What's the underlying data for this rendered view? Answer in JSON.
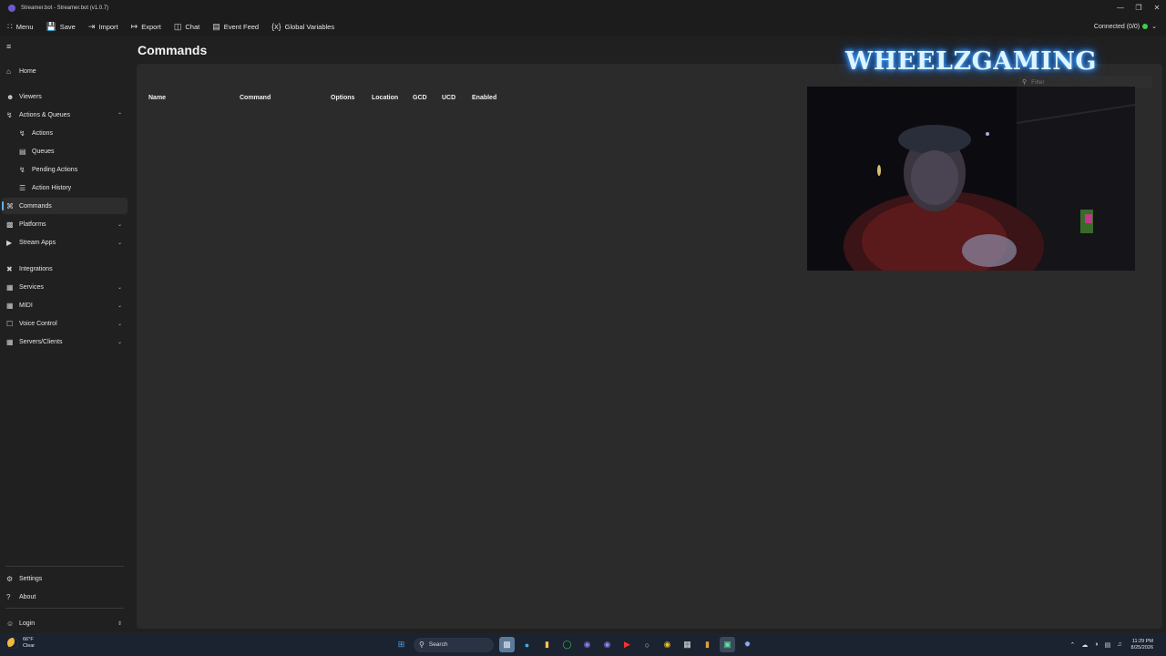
{
  "window": {
    "title": "Streamer.bot - Streamer.bot (v1.0.7)"
  },
  "toolbar": {
    "menu": "Menu",
    "save": "Save",
    "import": "Import",
    "export": "Export",
    "chat": "Chat",
    "event_feed": "Event Feed",
    "global_variables": "Global Variables",
    "connection_status": "Connected (0/0)"
  },
  "sidebar": {
    "home": "Home",
    "viewers": "Viewers",
    "actions_queues": "Actions & Queues",
    "actions": "Actions",
    "queues": "Queues",
    "pending_actions": "Pending Actions",
    "action_history": "Action History",
    "commands": "Commands",
    "platforms": "Platforms",
    "stream_apps": "Stream Apps",
    "integrations": "Integrations",
    "services": "Services",
    "midi": "MIDI",
    "voice_control": "Voice Control",
    "servers_clients": "Servers/Clients",
    "settings": "Settings",
    "about": "About",
    "login": "Login"
  },
  "main": {
    "title": "Commands",
    "filter_placeholder": "Filter",
    "columns": [
      "Name",
      "Command",
      "Options",
      "Location",
      "GCD",
      "UCD",
      "Enabled"
    ]
  },
  "overlay": {
    "logo_text": "WHEELZGAMING"
  },
  "taskbar": {
    "temperature": "66°F",
    "weather": "Clear",
    "search": "Search",
    "time": "11:29 PM",
    "date": "8/25/2026"
  },
  "colors": {
    "accent": "#5fb2f2",
    "connected": "#3ccf4e",
    "logo_glow": "#2b8cff"
  }
}
